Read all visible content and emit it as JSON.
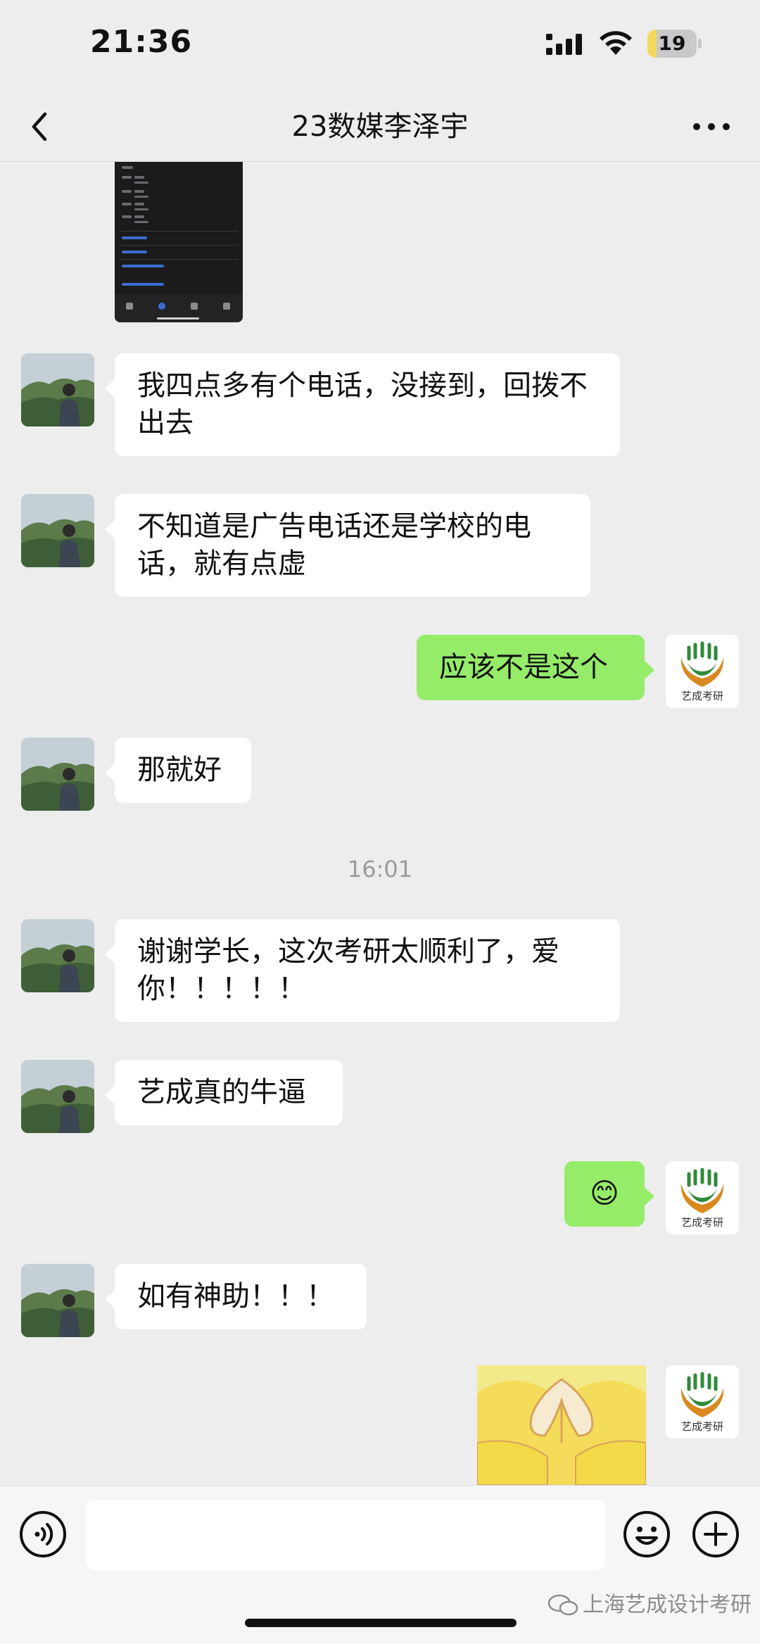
{
  "status_bar": {
    "time": "21:36",
    "battery": "19",
    "battery_level_percent": 19,
    "icons": [
      "signal-icon",
      "wifi-icon",
      "battery-icon"
    ]
  },
  "nav": {
    "title": "23数媒李泽宇",
    "back_icon": "chevron-left-icon",
    "more_icon": "more-dots-icon"
  },
  "messages": [
    {
      "sender": "contact",
      "text": "我四点多有个电话，没接到，回拨不出去"
    },
    {
      "sender": "contact",
      "text": "不知道是广告电话还是学校的电话，就有点虚"
    },
    {
      "sender": "me",
      "text": "应该不是这个"
    },
    {
      "sender": "contact",
      "text": "那就好"
    },
    {
      "sender": "contact",
      "text": "谢谢学长，这次考研太顺利了，爱你！！！！！"
    },
    {
      "sender": "contact",
      "text": "艺成真的牛逼"
    },
    {
      "sender": "me",
      "text": "😊"
    },
    {
      "sender": "contact",
      "text": "如有神助！！！"
    }
  ],
  "timestamp": "16:01",
  "logo_text": "艺成考研",
  "input_bar": {
    "icons": [
      "voice-icon",
      "emoji-icon",
      "plus-icon"
    ],
    "watermark": "上海艺成设计考研"
  },
  "colors": {
    "background": "#ededed",
    "my_bubble": "#95ec69",
    "their_bubble": "#ffffff",
    "logo_green": "#2f8a3a",
    "logo_orange": "#d9891f",
    "battery": "#f3d95a"
  }
}
